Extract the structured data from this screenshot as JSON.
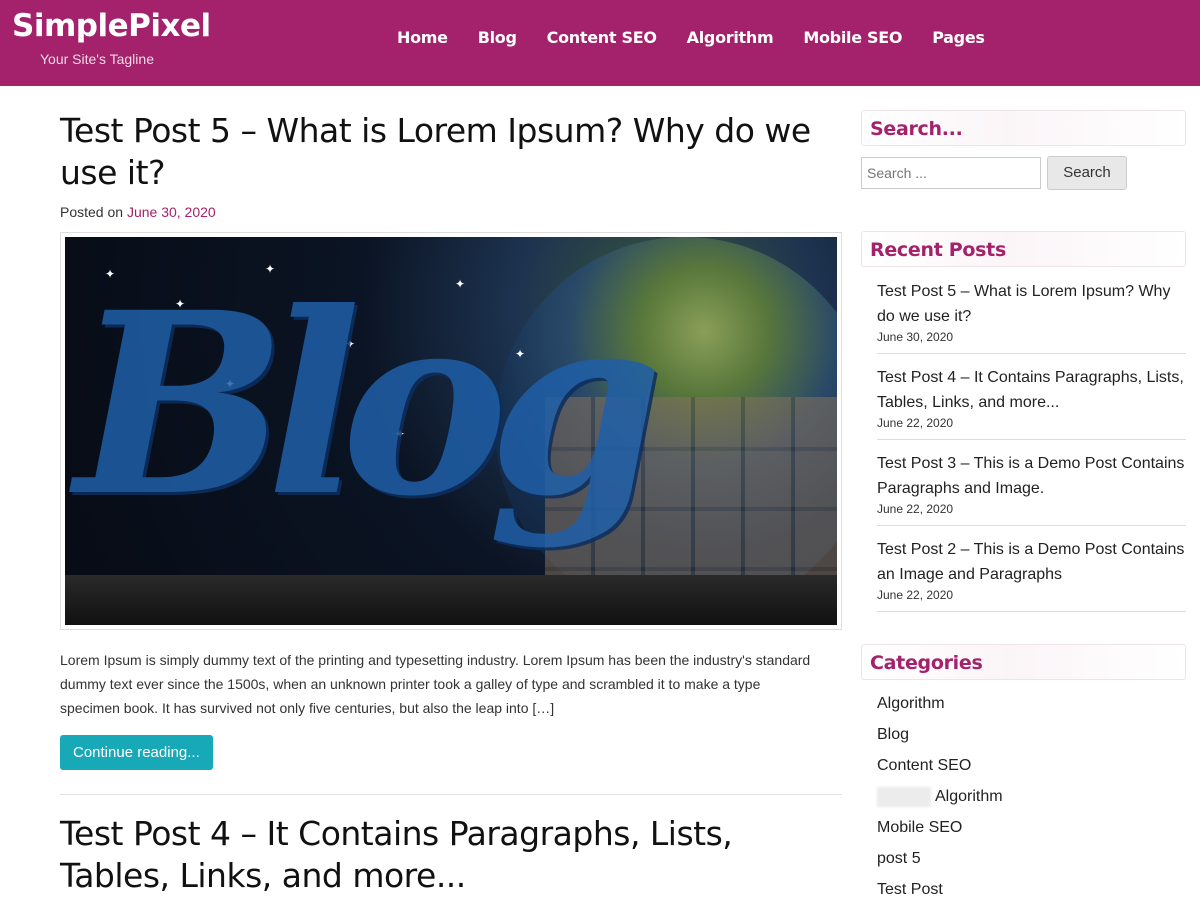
{
  "site": {
    "title": "SimplePixel",
    "tagline": "Your Site's Tagline"
  },
  "nav": [
    "Home",
    "Blog",
    "Content SEO",
    "Algorithm",
    "Mobile SEO",
    "Pages"
  ],
  "post1": {
    "title": "Test Post 5 – What is Lorem Ipsum? Why do we use it?",
    "meta_prefix": "Posted on",
    "date": "June 30, 2020",
    "image_word": "Blog",
    "excerpt": "Lorem Ipsum is simply dummy text of the printing and typesetting industry. Lorem Ipsum has been the industry's standard dummy text ever since the 1500s, when an unknown printer took a galley of type and scrambled it to make a type specimen book. It has survived not only five centuries, but also the leap into […]",
    "continue_label": "Continue reading..."
  },
  "post2": {
    "title": "Test Post 4 – It Contains Paragraphs, Lists, Tables, Links, and more..."
  },
  "sidebar": {
    "search": {
      "title": "Search...",
      "placeholder": "Search ...",
      "button": "Search"
    },
    "recent": {
      "title": "Recent Posts",
      "items": [
        {
          "title": "Test Post 5 – What is Lorem Ipsum? Why do we use it?",
          "date": "June 30, 2020"
        },
        {
          "title": "Test Post 4 – It Contains Paragraphs, Lists, Tables, Links, and more...",
          "date": "June 22, 2020"
        },
        {
          "title": "Test Post 3 – This is a Demo Post Contains Paragraphs and Image.",
          "date": "June 22, 2020"
        },
        {
          "title": "Test Post 2 – This is a Demo Post Contains an Image and Paragraphs",
          "date": "June 22, 2020"
        }
      ]
    },
    "categories": {
      "title": "Categories",
      "items": [
        "Algorithm",
        "Blog",
        "Content SEO",
        "Algorithm",
        "Mobile SEO",
        "post 5",
        "Test Post"
      ]
    }
  },
  "colors": {
    "brand": "#a4226b",
    "button": "#18a9b8"
  }
}
